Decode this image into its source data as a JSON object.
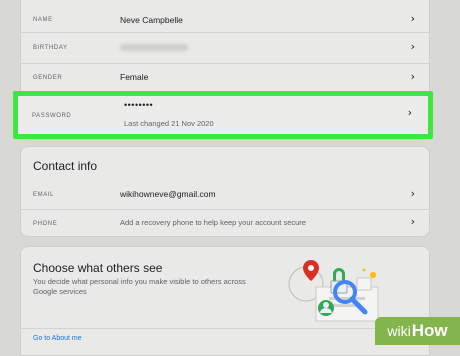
{
  "personal": {
    "name_label": "NAME",
    "name_value": "Neve Campbelle",
    "birthday_label": "BIRTHDAY",
    "gender_label": "GENDER",
    "gender_value": "Female",
    "password_label": "PASSWORD",
    "password_value": "••••••••",
    "password_sub": "Last changed 21 Nov 2020"
  },
  "contact": {
    "title": "Contact info",
    "email_label": "EMAIL",
    "email_value": "wikihowneve@gmail.com",
    "phone_label": "PHONE",
    "phone_value": "Add a recovery phone to help keep your account secure"
  },
  "others": {
    "title": "Choose what others see",
    "description": "You decide what personal info you make visible to others across Google services",
    "link": "Go to About me"
  },
  "watermark": {
    "wiki": "wiki",
    "how": "How"
  },
  "icons": {
    "chevron": "chevron-right-icon"
  },
  "colors": {
    "highlight": "#3ee63e",
    "link": "#1a73e8",
    "watermark": "#84b54c"
  }
}
